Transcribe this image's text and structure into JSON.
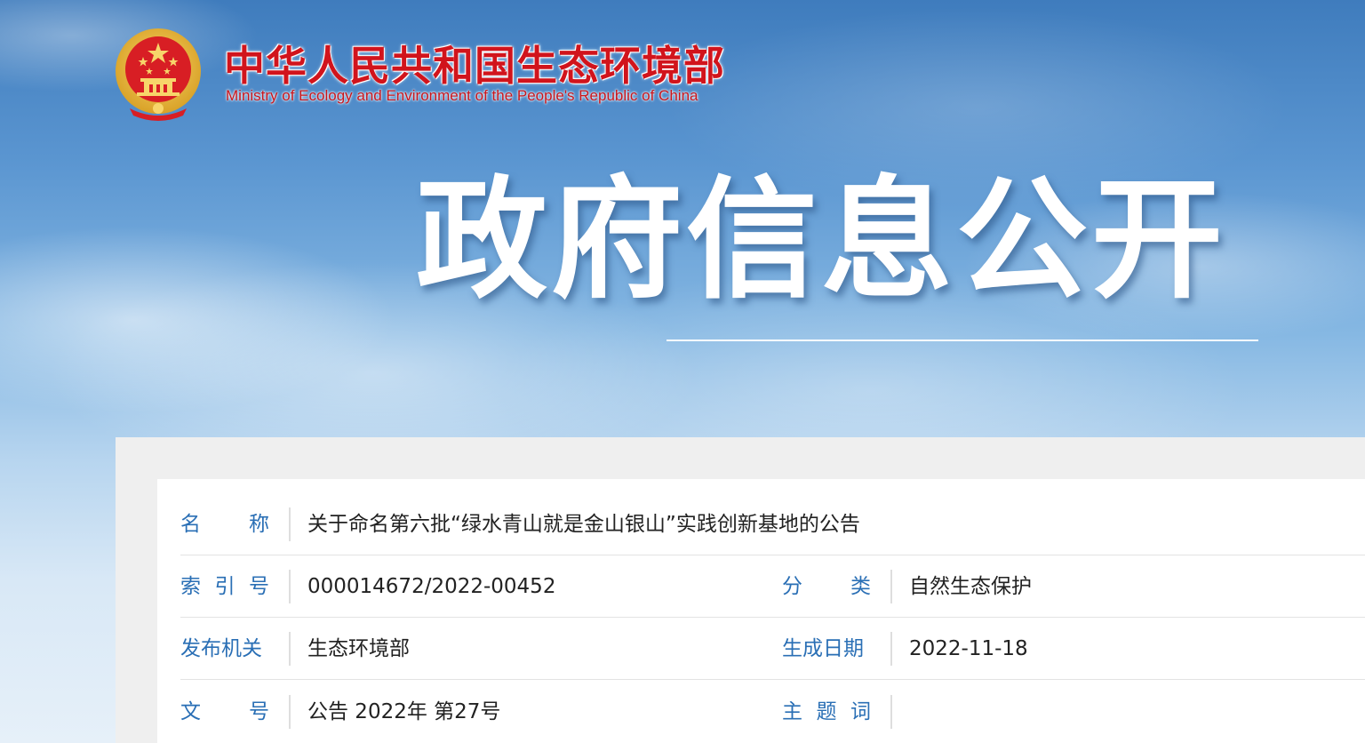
{
  "header": {
    "org_name_cn": "中华人民共和国生态环境部",
    "org_name_en": "Ministry of Ecology and Environment of the People's Republic of China",
    "emblem_icon": "national-emblem-icon"
  },
  "banner": {
    "title": "政府信息公开"
  },
  "info_table": {
    "rows": [
      {
        "label1": [
          "名",
          "称"
        ],
        "value1": "关于命名第六批“绿水青山就是金山银山”实践创新基地的公告"
      },
      {
        "label1": [
          "索",
          "引",
          "号"
        ],
        "value1": "000014672/2022-00452",
        "label2": [
          "分",
          "类"
        ],
        "value2": "自然生态保护"
      },
      {
        "label1": [
          "发布机关"
        ],
        "value1": "生态环境部",
        "label2": [
          "生成日期"
        ],
        "value2": "2022-11-18"
      },
      {
        "label1": [
          "文",
          "号"
        ],
        "value1": "公告 2022年 第27号",
        "label2": [
          "主",
          "题",
          "词"
        ],
        "value2": ""
      }
    ]
  },
  "colors": {
    "brand_red": "#d1141c",
    "label_blue": "#2a6fb5"
  }
}
